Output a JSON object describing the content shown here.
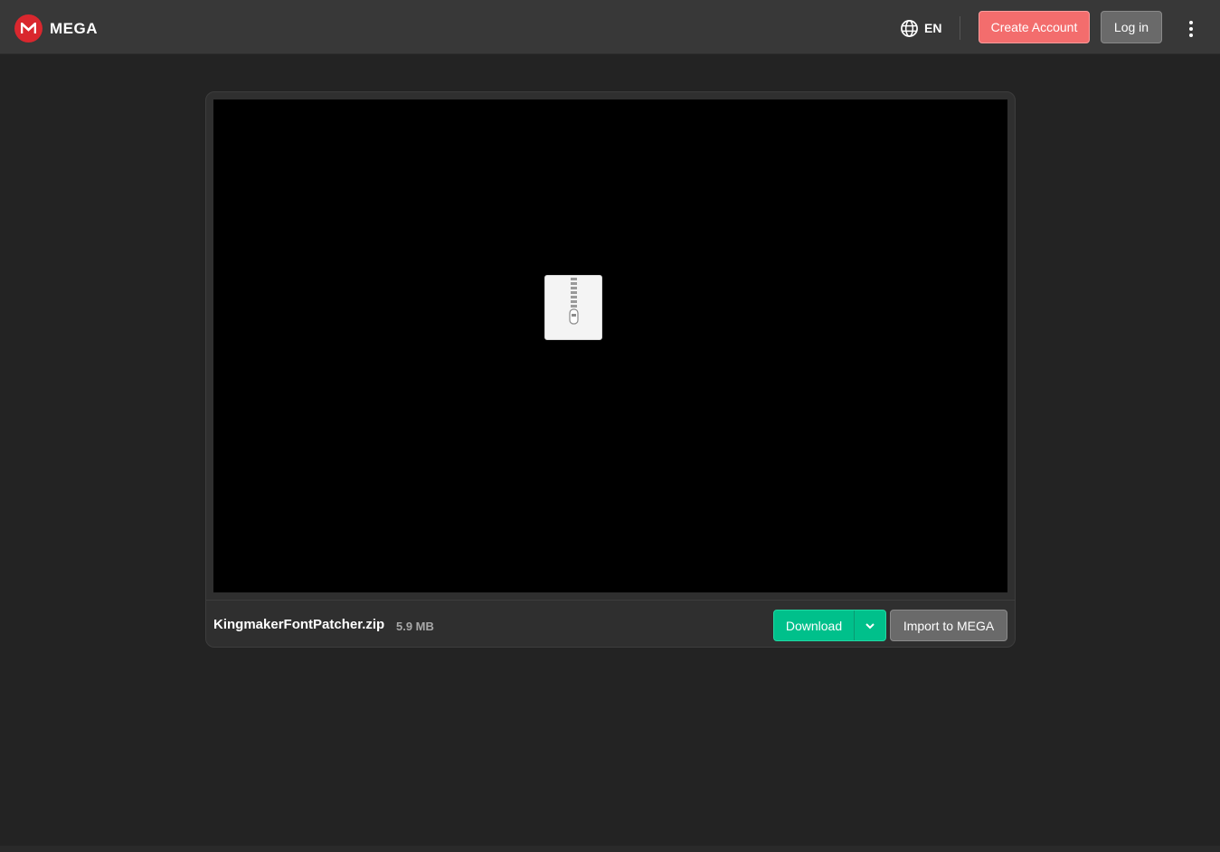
{
  "header": {
    "brand": "MEGA",
    "logo_letter": "M",
    "language": "EN",
    "create_account_label": "Create Account",
    "login_label": "Log in"
  },
  "file": {
    "name": "KingmakerFontPatcher.zip",
    "size": "5.9 MB"
  },
  "actions": {
    "download_label": "Download",
    "import_label": "Import to MEGA"
  },
  "colors": {
    "brand_red": "#d9272e",
    "create_account": "#f36d6d",
    "download_green": "#00c08b",
    "background": "#232323",
    "topbar": "#383838"
  },
  "icons": {
    "globe": "globe-icon",
    "menu": "more-vertical-icon",
    "file_type": "zip-file-icon",
    "dropdown": "chevron-down-icon"
  }
}
